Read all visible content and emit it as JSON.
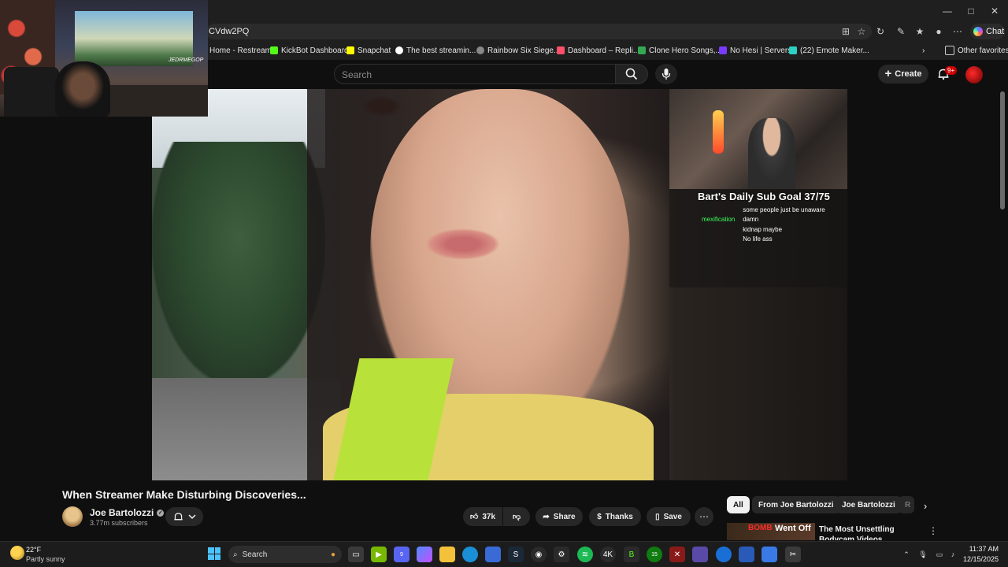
{
  "browser": {
    "address_text": "CVdw2PQ",
    "chat_label": "Chat",
    "window_buttons": [
      "—",
      "□",
      "✕"
    ]
  },
  "favorites": [
    {
      "label": "Home - Restream",
      "color": "#3f7fff"
    },
    {
      "label": "KickBot Dashboard",
      "color": "#53fc18"
    },
    {
      "label": "Snapchat",
      "color": "#fffc00"
    },
    {
      "label": "The best streamin...",
      "color": "#ffffff"
    },
    {
      "label": "Rainbow Six Siege...",
      "color": "#888888"
    },
    {
      "label": "Dashboard – Repli...",
      "color": "#ff4f6a"
    },
    {
      "label": "Clone Hero Songs,...",
      "color": "#34a853"
    },
    {
      "label": "No Hesi | Servers",
      "color": "#7a3aff"
    },
    {
      "label": "(22) Emote Maker...",
      "color": "#2ad1c4"
    }
  ],
  "other_favorites": "Other favorites",
  "youtube": {
    "search_placeholder": "Search",
    "create_label": "Create",
    "notif_badge": "9+"
  },
  "stream_overlay": {
    "webcam_logo": "JEDRMEGOP",
    "sub_goal": "Bart's Daily Sub Goal 37/75",
    "chat": [
      {
        "user": "",
        "message": "some people just be unaware",
        "color": "#9a7aff"
      },
      {
        "user": "mexification",
        "message": "damn",
        "color": "#3aff5a"
      },
      {
        "user": "",
        "message": "kidnap maybe",
        "color": "#3aa83a"
      },
      {
        "user": "",
        "message": "No life ass",
        "color": "#ff3a3a"
      }
    ]
  },
  "video": {
    "title": "When Streamer Make Disturbing Discoveries...",
    "channel_name": "Joe Bartolozzi",
    "subscribers": "3.77m subscribers",
    "likes": "37k",
    "share_label": "Share",
    "thanks_label": "Thanks",
    "save_label": "Save"
  },
  "sidebar": {
    "chips": [
      "All",
      "From Joe Bartolozzi",
      "Joe Bartolozzi",
      "R"
    ],
    "active_chip": "All",
    "recommendation": {
      "thumb_text_1": "BOMB",
      "thumb_text_2": "Went Off",
      "title": "The Most Unsettling Bodycam Videos"
    }
  },
  "taskbar": {
    "temperature": "22°F",
    "condition": "Partly sunny",
    "search_label": "Search",
    "time": "11:37 AM",
    "date": "12/15/2025",
    "badges": {
      "discord": "9",
      "xbox": "15"
    }
  }
}
